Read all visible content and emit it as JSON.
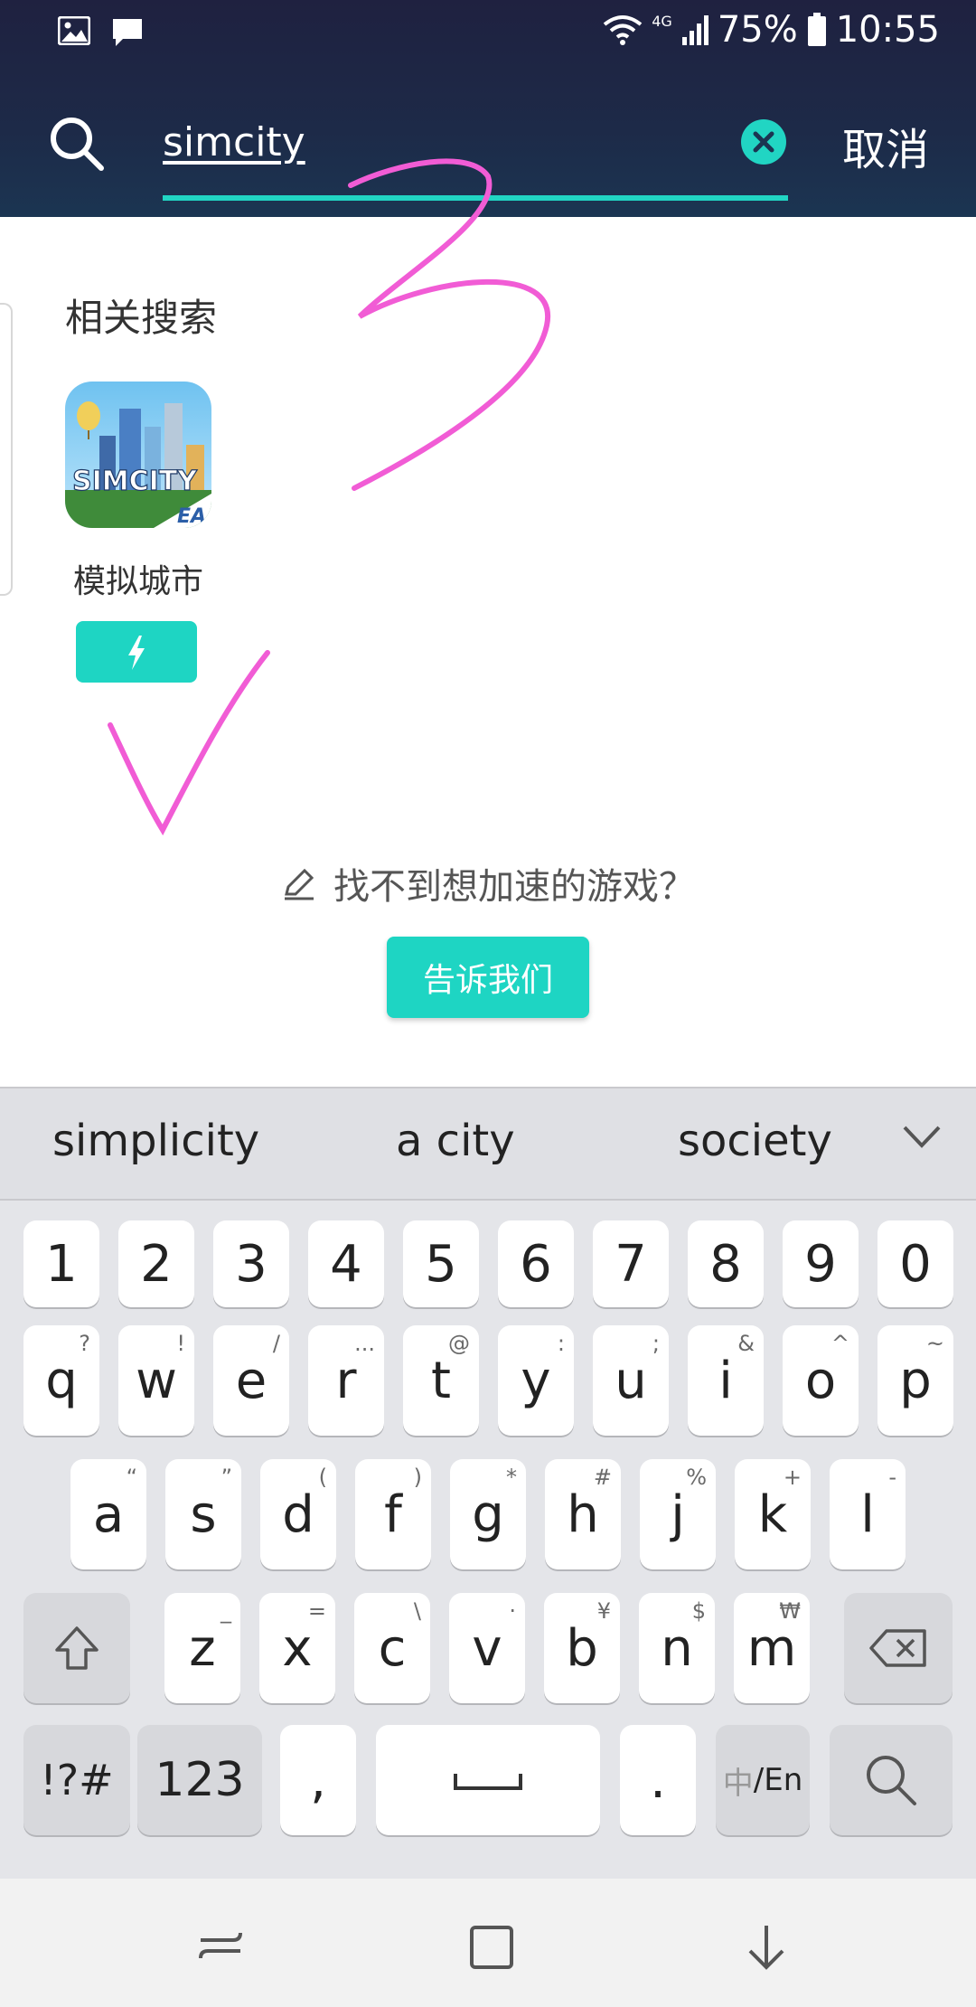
{
  "status_bar": {
    "network": "4G",
    "battery": "75%",
    "time": "10:55",
    "icons": [
      "image-icon",
      "message-icon",
      "wifi-icon",
      "signal-icon",
      "battery-icon"
    ]
  },
  "search": {
    "query": "simcity",
    "cancel_label": "取消"
  },
  "related": {
    "title": "相关搜索",
    "apps": [
      {
        "name": "模拟城市",
        "icon_text": "SIMCITY",
        "publisher_badge": "EA"
      }
    ]
  },
  "feedback": {
    "prompt": "找不到想加速的游戏？",
    "button_label": "告诉我们"
  },
  "keyboard": {
    "suggestions": [
      "simplicity",
      "a city",
      "society"
    ],
    "row_numbers": [
      "1",
      "2",
      "3",
      "4",
      "5",
      "6",
      "7",
      "8",
      "9",
      "0"
    ],
    "row1": [
      {
        "k": "q",
        "h": "?"
      },
      {
        "k": "w",
        "h": "!"
      },
      {
        "k": "e",
        "h": "/"
      },
      {
        "k": "r",
        "h": "..."
      },
      {
        "k": "t",
        "h": "@"
      },
      {
        "k": "y",
        "h": ":"
      },
      {
        "k": "u",
        "h": ";"
      },
      {
        "k": "i",
        "h": "&"
      },
      {
        "k": "o",
        "h": "^"
      },
      {
        "k": "p",
        "h": "~"
      }
    ],
    "row2": [
      {
        "k": "a",
        "h": "“"
      },
      {
        "k": "s",
        "h": "”"
      },
      {
        "k": "d",
        "h": "("
      },
      {
        "k": "f",
        "h": ")"
      },
      {
        "k": "g",
        "h": "*"
      },
      {
        "k": "h",
        "h": "#"
      },
      {
        "k": "j",
        "h": "%"
      },
      {
        "k": "k",
        "h": "+"
      },
      {
        "k": "l",
        "h": "-"
      }
    ],
    "row3": [
      {
        "k": "z",
        "h": "_"
      },
      {
        "k": "x",
        "h": "="
      },
      {
        "k": "c",
        "h": "\\"
      },
      {
        "k": "v",
        "h": "·"
      },
      {
        "k": "b",
        "h": "¥"
      },
      {
        "k": "n",
        "h": "$"
      },
      {
        "k": "m",
        "h": "₩"
      }
    ],
    "sym_label": "!?#",
    "num_label": "123",
    "comma": ",",
    "period": ".",
    "lang_label_a": "中",
    "lang_label_b": "/En"
  },
  "colors": {
    "accent": "#1ed5c3",
    "header": "#1f2140",
    "annotation": "#f15cd5"
  }
}
